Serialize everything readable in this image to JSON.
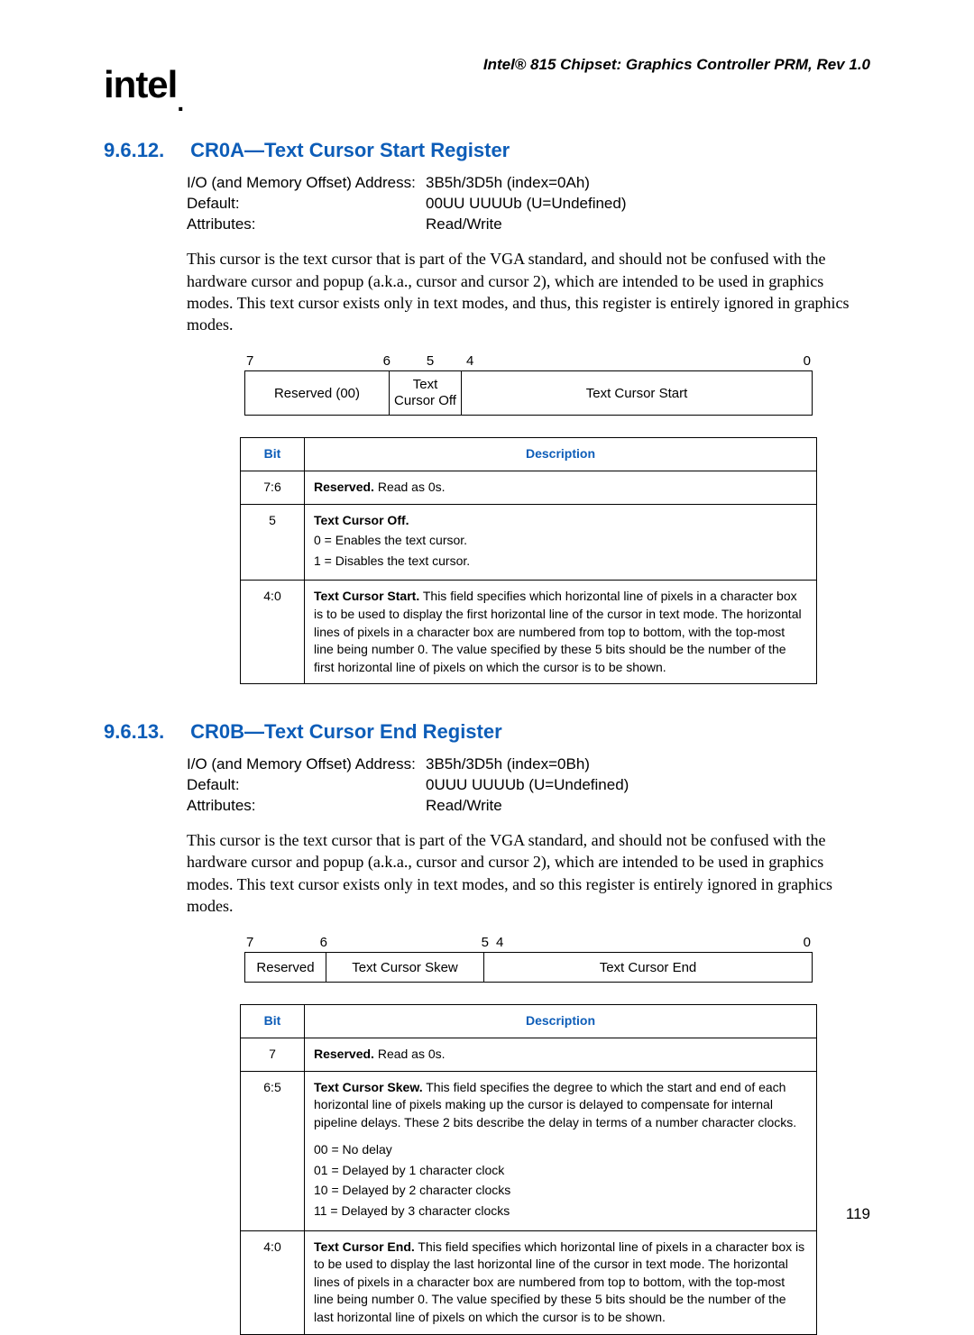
{
  "header": {
    "doc_title": "Intel® 815 Chipset: Graphics Controller PRM, Rev 1.0",
    "logo_text": "intel",
    "logo_dot": "."
  },
  "page_number": "119",
  "sections": [
    {
      "num": "9.6.12.",
      "title": "CR0A—Text Cursor Start Register",
      "attrs": {
        "addr_label": "I/O (and Memory Offset) Address:",
        "addr_value": "3B5h/3D5h (index=0Ah)",
        "default_label": "Default:",
        "default_value": "00UU UUUUb (U=Undefined)",
        "attributes_label": "Attributes:",
        "attributes_value": "Read/Write"
      },
      "body": "This cursor is the text cursor that is part of the VGA standard, and should not be confused with the hardware cursor and popup (a.k.a., cursor and cursor 2), which are intended to be used in graphics modes. This text cursor exists only in text modes, and thus, this register is entirely ignored in graphics modes.",
      "layout": {
        "nums": [
          "7",
          "6",
          "5",
          "4",
          "0"
        ],
        "cells": [
          "Reserved (00)",
          "Text Cursor Off",
          "Text Cursor Start"
        ]
      },
      "table": {
        "head_bit": "Bit",
        "head_desc": "Description",
        "rows": [
          {
            "bit": "7:6",
            "bold": "Reserved.",
            "rest": " Read as 0s."
          },
          {
            "bit": "5",
            "bold": "Text Cursor Off.",
            "lines": [
              "0 = Enables the text cursor.",
              "1 = Disables the text cursor."
            ]
          },
          {
            "bit": "4:0",
            "bold": "Text Cursor Start.",
            "rest": " This field specifies which horizontal line of pixels in a character box is to be used to display the first horizontal line of the cursor in text mode. The horizontal lines of pixels in a character box are numbered from top to bottom, with the top-most line being number 0. The value specified by these 5 bits should be the number of the first horizontal line of pixels on which the cursor is to be shown."
          }
        ]
      }
    },
    {
      "num": "9.6.13.",
      "title": "CR0B—Text Cursor End Register",
      "attrs": {
        "addr_label": "I/O (and Memory Offset) Address:",
        "addr_value": "3B5h/3D5h (index=0Bh)",
        "default_label": "Default:",
        "default_value": "0UUU UUUUb (U=Undefined)",
        "attributes_label": "Attributes:",
        "attributes_value": "Read/Write"
      },
      "body": "This cursor is the text cursor that is part of the VGA standard, and should not be confused with the hardware cursor and popup (a.k.a., cursor and cursor 2), which are intended to be used in graphics modes. This text cursor exists only in text modes, and so this register is entirely ignored in graphics modes.",
      "layout": {
        "nums": [
          "7",
          "6",
          "5",
          "4",
          "0"
        ],
        "cells": [
          "Reserved",
          "Text Cursor Skew",
          "Text Cursor End"
        ]
      },
      "table": {
        "head_bit": "Bit",
        "head_desc": "Description",
        "rows": [
          {
            "bit": "7",
            "bold": "Reserved.",
            "rest": " Read as 0s."
          },
          {
            "bit": "6:5",
            "bold": "Text Cursor Skew.",
            "rest": " This field specifies the degree to which the start and end of each horizontal line of pixels making up the cursor is delayed to compensate for internal pipeline delays. These 2 bits describe the delay in terms of a number character clocks.",
            "lines": [
              "00 = No delay",
              "01 = Delayed by 1 character clock",
              "10 = Delayed by 2 character clocks",
              "11 = Delayed by 3 character clocks"
            ]
          },
          {
            "bit": "4:0",
            "bold": "Text Cursor End.",
            "rest": " This field specifies which horizontal line of pixels in a character box is to be used to display the last horizontal line of the cursor in text mode. The horizontal lines of pixels in a character box are numbered from top to bottom, with the top-most line being number 0. The value specified by these 5 bits should be the number of the last horizontal line of pixels on which the cursor is to be shown."
          }
        ]
      }
    }
  ]
}
